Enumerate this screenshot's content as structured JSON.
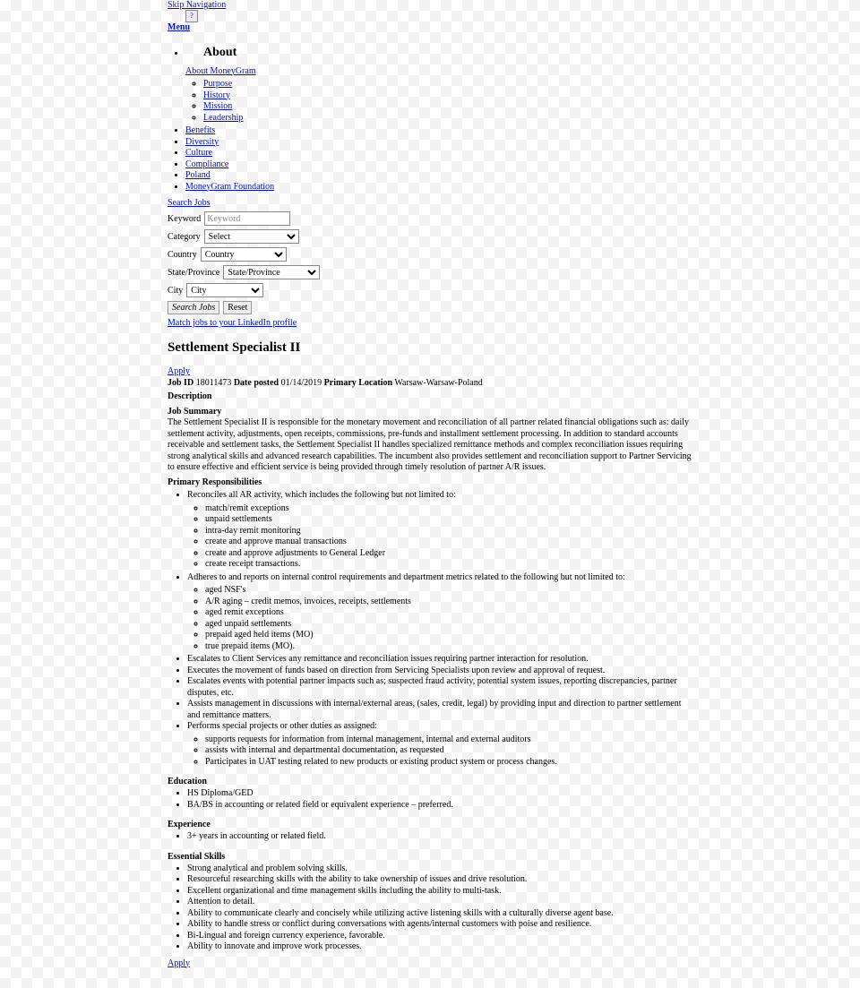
{
  "skipNav": "Skip Navigation",
  "iconLabel": "?",
  "menuLabel": "Menu",
  "about": {
    "heading": "About",
    "topLink": "About MoneyGram",
    "subLinks": [
      "Purpose",
      "History",
      "Mission",
      "Leadership"
    ],
    "links": [
      "Benefits",
      "Diversity",
      "Culture",
      "Compliance",
      "Poland",
      "MoneyGram Foundation"
    ]
  },
  "search": {
    "searchJobsLink": "Search Jobs",
    "keywordLabel": "Keyword",
    "keywordPlaceholder": "Keyword",
    "categoryLabel": "Category",
    "categorySelected": "Select",
    "countryLabel": "Country",
    "countrySelected": "Country",
    "stateLabel": "State/Province",
    "stateSelected": "State/Province",
    "cityLabel": "City",
    "citySelected": "City",
    "searchButton": "Search Jobs",
    "resetButton": "Reset",
    "linkedinLink": "Match jobs to your LinkedIn profile"
  },
  "job": {
    "title": "Settlement Specialist II",
    "applyLabel": "Apply",
    "jobIdLabel": "Job ID",
    "jobId": "18011473",
    "datePostedLabel": "Date posted",
    "datePosted": "01/14/2019",
    "primaryLocationLabel": "Primary Location",
    "primaryLocation": "Warsaw-Warsaw-Poland",
    "descriptionLabel": "Description",
    "jobSummaryLabel": "Job Summary",
    "summary": "The Settlement Specialist II is responsible for the monetary movement and reconciliation of all partner related financial obligations such as: daily settlement activity, adjustments, open receipts, commissions, pre‑funds and installment settlement processing. In addition to standard accounts receivable and settlement tasks, the Settlement Specialist II handles specialized remittance methods and complex reconciliation issues requiring strong analytical skills and advanced research capabilities. The incumbent also provides settlement and reconciliation support to Partner Servicing to ensure effective and efficient service is being provided through timely resolution of partner A/R issues.",
    "primaryRespLabel": "Primary Responsibilities",
    "resp": {
      "r1": "Reconciles all AR activity, which includes the following but not limited to:",
      "r1sub": [
        "match/remit exceptions",
        "unpaid settlements",
        "intra‑day remit monitoring",
        "create and approve manual transactions",
        "create and approve adjustments to General Ledger",
        "create receipt transactions."
      ],
      "r2": "Adheres to and reports on internal control requirements and department metrics related to the following but not limited to:",
      "r2sub": [
        "aged NSF's",
        "A/R aging – credit memos, invoices, receipts, settlements",
        "aged remit exceptions",
        "aged unpaid settlements",
        "prepaid aged held items (MO)",
        "true prepaid items (MO)."
      ],
      "r3": "Escalates to Client Services any remittance and reconciliation issues requiring partner interaction for resolution.",
      "r4": "Executes the movement of funds based on direction from Servicing Specialists upon review and approval of request.",
      "r5": "Escalates events with potential partner impacts such as; suspected fraud activity, potential system issues, reporting discrepancies, partner disputes, etc.",
      "r6": "Assists management in discussions with internal/external areas, (sales, credit, legal) by providing input and direction to partner settlement and remittance matters.",
      "r7": "Performs special projects or other duties as assigned:",
      "r7sub": [
        "supports requests for information from internal management, internal and external auditors",
        "assists with internal and departmental documentation, as requested",
        "Participates in UAT testing related to new products or existing product system or process changes."
      ]
    },
    "educationLabel": "Education",
    "education": [
      "HS Diploma/GED",
      "BA/BS in accounting or related field or equivalent experience – preferred."
    ],
    "experienceLabel": "Experience",
    "experience": [
      "3+ years in accounting or related field."
    ],
    "essentialLabel": "Essential Skills",
    "essential": [
      "Strong analytical and problem solving skills.",
      "Resourceful researching skills with the ability to take ownership of issues and drive resolution.",
      "Excellent organizational and time management skills including the ability to multi‑task.",
      "Attention to detail.",
      "Ability to communicate clearly and concisely while utilizing active listening skills with a culturally diverse agent base.",
      "Ability to handle stress or conflict during conversations with agents/internal customers with poise and resilience.",
      "Bi‑Lingual and foreign currency experience, favorable.",
      "Ability to innovate and improve work processes."
    ],
    "applyBottom": "Apply"
  }
}
